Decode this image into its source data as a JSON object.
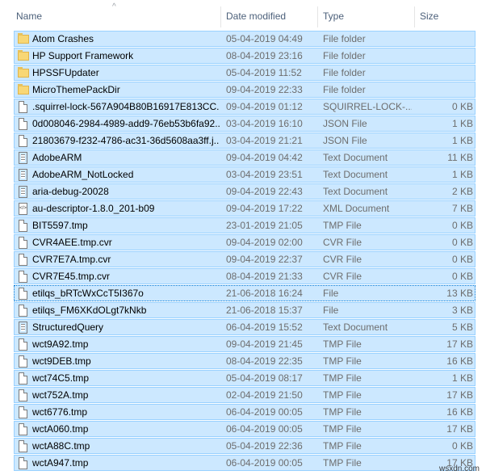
{
  "columns": {
    "name": "Name",
    "date": "Date modified",
    "type": "Type",
    "size": "Size"
  },
  "rows": [
    {
      "name": "Atom Crashes",
      "date": "05-04-2019 04:49",
      "type": "File folder",
      "size": "",
      "icon": "folder-icon"
    },
    {
      "name": "HP Support Framework",
      "date": "08-04-2019 23:16",
      "type": "File folder",
      "size": "",
      "icon": "folder-icon"
    },
    {
      "name": "HPSSFUpdater",
      "date": "05-04-2019 11:52",
      "type": "File folder",
      "size": "",
      "icon": "folder-icon"
    },
    {
      "name": "MicroThemePackDir",
      "date": "09-04-2019 22:33",
      "type": "File folder",
      "size": "",
      "icon": "folder-icon"
    },
    {
      "name": ".squirrel-lock-567A904B80B16917E813CC...",
      "date": "09-04-2019 01:12",
      "type": "SQUIRREL-LOCK-...",
      "size": "0 KB",
      "icon": "file-icon"
    },
    {
      "name": "0d008046-2984-4989-add9-76eb53b6fa92...",
      "date": "03-04-2019 16:10",
      "type": "JSON File",
      "size": "1 KB",
      "icon": "file-icon"
    },
    {
      "name": "21803679-f232-4786-ac31-36d5608aa3ff.j...",
      "date": "03-04-2019 21:21",
      "type": "JSON File",
      "size": "1 KB",
      "icon": "file-icon"
    },
    {
      "name": "AdobeARM",
      "date": "09-04-2019 04:42",
      "type": "Text Document",
      "size": "11 KB",
      "icon": "text-icon"
    },
    {
      "name": "AdobeARM_NotLocked",
      "date": "03-04-2019 23:51",
      "type": "Text Document",
      "size": "1 KB",
      "icon": "text-icon"
    },
    {
      "name": "aria-debug-20028",
      "date": "09-04-2019 22:43",
      "type": "Text Document",
      "size": "2 KB",
      "icon": "text-icon"
    },
    {
      "name": "au-descriptor-1.8.0_201-b09",
      "date": "09-04-2019 17:22",
      "type": "XML Document",
      "size": "7 KB",
      "icon": "xml-icon"
    },
    {
      "name": "BIT5597.tmp",
      "date": "23-01-2019 21:05",
      "type": "TMP File",
      "size": "0 KB",
      "icon": "file-icon"
    },
    {
      "name": "CVR4AEE.tmp.cvr",
      "date": "09-04-2019 02:00",
      "type": "CVR File",
      "size": "0 KB",
      "icon": "file-icon"
    },
    {
      "name": "CVR7E7A.tmp.cvr",
      "date": "09-04-2019 22:37",
      "type": "CVR File",
      "size": "0 KB",
      "icon": "file-icon"
    },
    {
      "name": "CVR7E45.tmp.cvr",
      "date": "08-04-2019 21:33",
      "type": "CVR File",
      "size": "0 KB",
      "icon": "file-icon"
    },
    {
      "name": "etilqs_bRTcWxCcT5I367o",
      "date": "21-06-2018 16:24",
      "type": "File",
      "size": "13 KB",
      "icon": "file-icon",
      "focused": true
    },
    {
      "name": "etilqs_FM6XKdOLgt7kNkb",
      "date": "21-06-2018 15:37",
      "type": "File",
      "size": "3 KB",
      "icon": "file-icon"
    },
    {
      "name": "StructuredQuery",
      "date": "06-04-2019 15:52",
      "type": "Text Document",
      "size": "5 KB",
      "icon": "text-icon"
    },
    {
      "name": "wct9A92.tmp",
      "date": "09-04-2019 21:45",
      "type": "TMP File",
      "size": "17 KB",
      "icon": "file-icon"
    },
    {
      "name": "wct9DEB.tmp",
      "date": "08-04-2019 22:35",
      "type": "TMP File",
      "size": "16 KB",
      "icon": "file-icon"
    },
    {
      "name": "wct74C5.tmp",
      "date": "05-04-2019 08:17",
      "type": "TMP File",
      "size": "1 KB",
      "icon": "file-icon"
    },
    {
      "name": "wct752A.tmp",
      "date": "02-04-2019 21:50",
      "type": "TMP File",
      "size": "17 KB",
      "icon": "file-icon"
    },
    {
      "name": "wct6776.tmp",
      "date": "06-04-2019 00:05",
      "type": "TMP File",
      "size": "16 KB",
      "icon": "file-icon"
    },
    {
      "name": "wctA060.tmp",
      "date": "06-04-2019 00:05",
      "type": "TMP File",
      "size": "17 KB",
      "icon": "file-icon"
    },
    {
      "name": "wctA88C.tmp",
      "date": "05-04-2019 22:36",
      "type": "TMP File",
      "size": "0 KB",
      "icon": "file-icon"
    },
    {
      "name": "wctA947.tmp",
      "date": "06-04-2019 00:05",
      "type": "TMP File",
      "size": "17 KB",
      "icon": "file-icon"
    }
  ],
  "watermark": "wsxdn.com"
}
